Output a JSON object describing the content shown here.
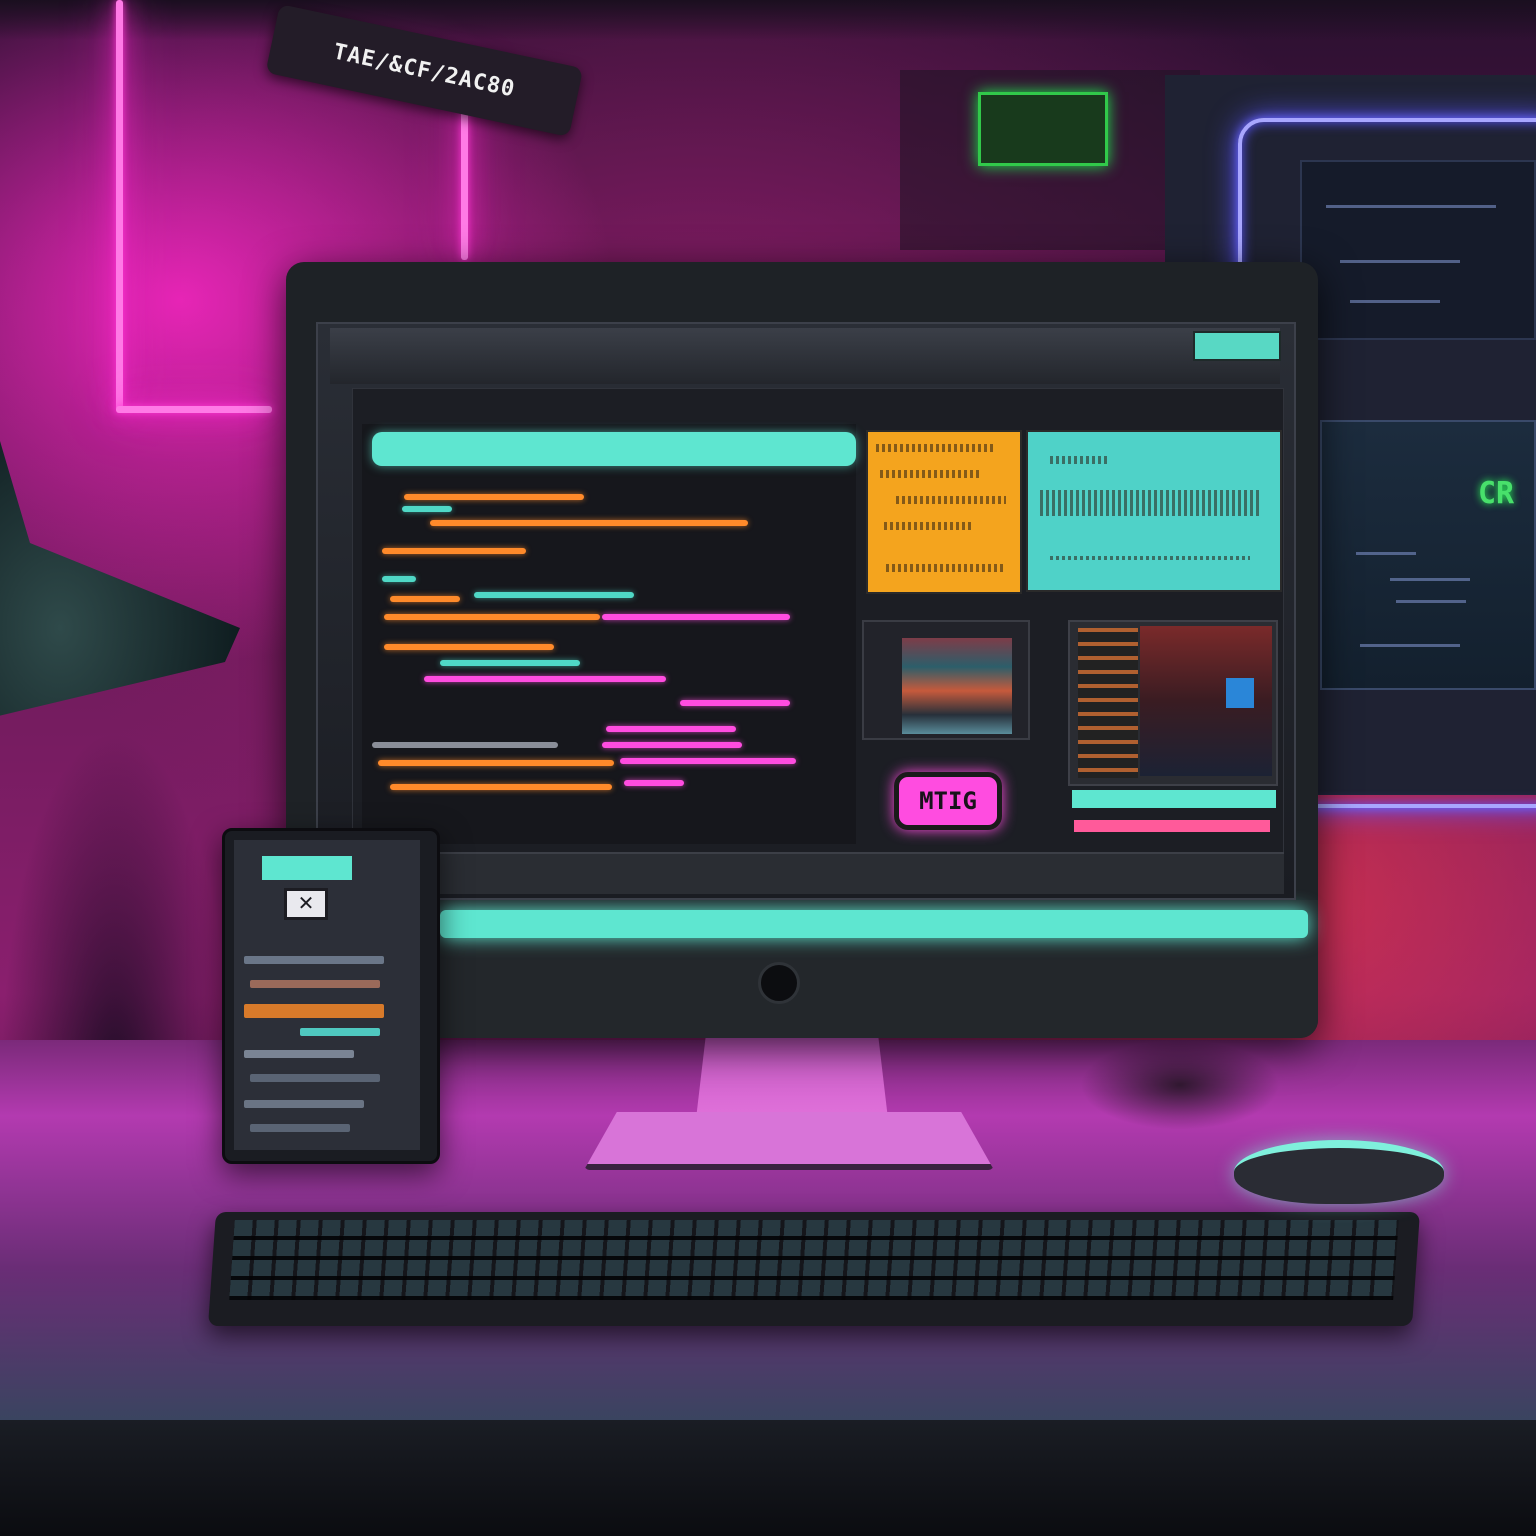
{
  "scene": {
    "wall_sign_text": "TAE/&CF/2AC80",
    "green_sign_text": "",
    "background_screen_text": "CR",
    "monitor_header_label": "",
    "monitor_button_label": "MTIG",
    "tablet_tab_label": "",
    "tablet_icon_glyph": "✕"
  },
  "colors": {
    "neon_pink": "#ff4ce0",
    "neon_teal": "#5ee6d0",
    "neon_blue": "#a8a6ff",
    "accent_orange": "#ff8a2a",
    "card_yellow": "#f4a41e",
    "neon_green": "#48e06b"
  }
}
